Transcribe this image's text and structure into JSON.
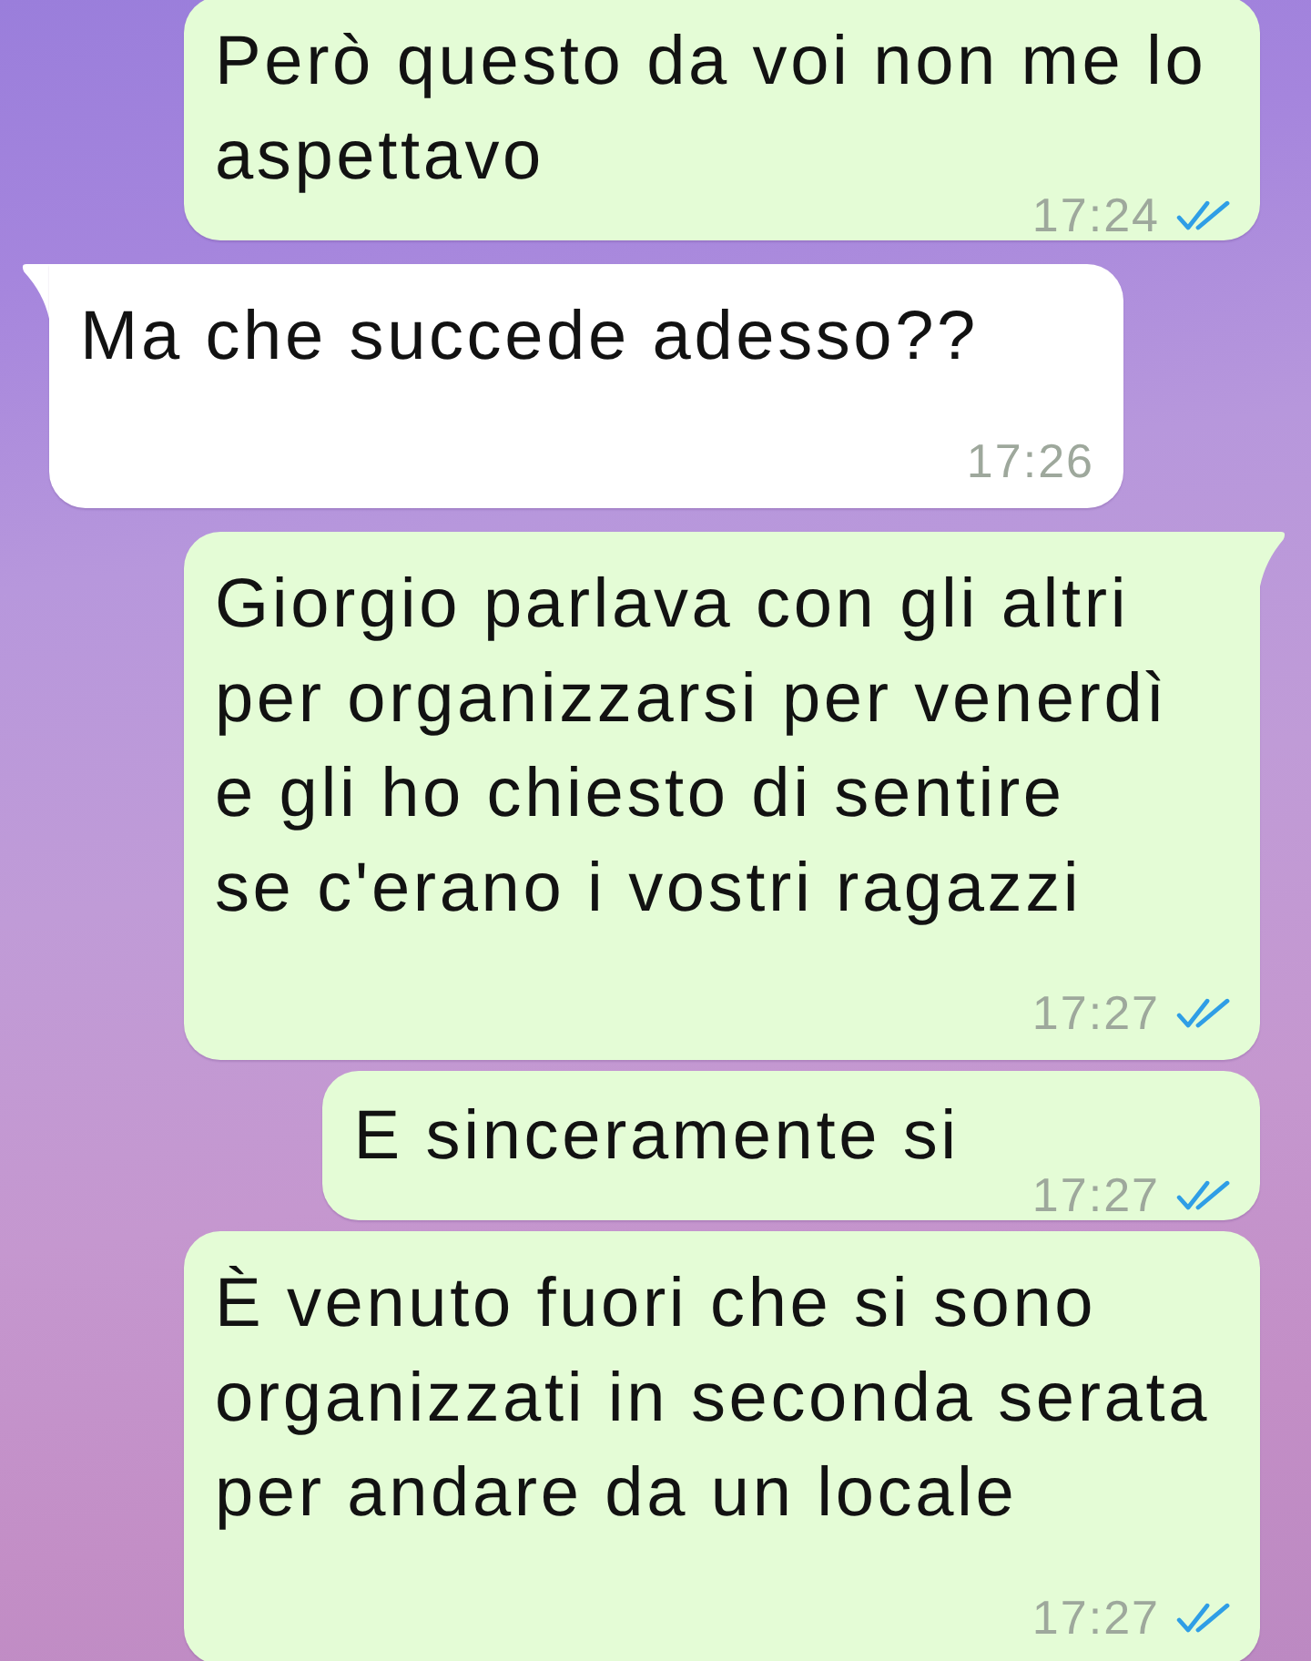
{
  "messages": [
    {
      "kind": "outgoing",
      "text": "Però questo da voi non me lo aspettavo",
      "time": "17:24",
      "read": true,
      "tail": false
    },
    {
      "kind": "incoming",
      "text": "Ma che succede adesso??",
      "time": "17:26",
      "tail": true
    },
    {
      "kind": "outgoing",
      "text": "Giorgio parlava con gli altri\nper organizzarsi per venerdì\ne gli ho chiesto di sentire\nse c'erano i vostri ragazzi",
      "time": "17:27",
      "read": true,
      "tail": true
    },
    {
      "kind": "outgoing",
      "text": "E sinceramente si",
      "time": "17:27",
      "read": true,
      "tail": false
    },
    {
      "kind": "outgoing",
      "text": "È venuto fuori che si sono organizzati in seconda serata per andare da un locale",
      "time": "17:27",
      "read": true,
      "tail": false
    }
  ]
}
